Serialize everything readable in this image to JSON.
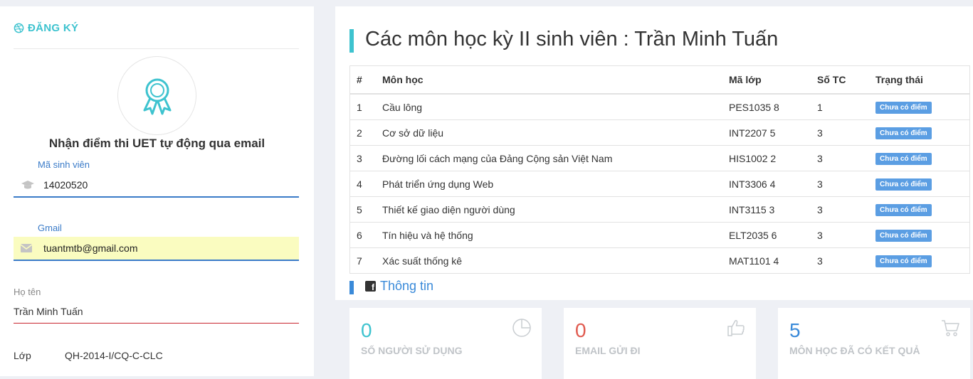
{
  "left": {
    "register_title": "ĐĂNG KÝ",
    "heading": "Nhận điểm thi UET tự động qua email",
    "student_id": {
      "label": "Mã sinh viên",
      "value": "14020520"
    },
    "gmail": {
      "label": "Gmail",
      "value": "tuantmtb@gmail.com"
    },
    "full_name": {
      "label": "Họ tên",
      "value": "Trần Minh Tuấn"
    },
    "class": {
      "label": "Lớp",
      "value": "QH-2014-I/CQ-C-CLC"
    }
  },
  "main": {
    "title": "Các môn học kỳ II sinh viên : Trần Minh Tuấn",
    "table": {
      "headers": [
        "#",
        "Môn học",
        "Mã lớp",
        "Số TC",
        "Trạng thái"
      ],
      "rows": [
        [
          "1",
          "Cầu lông",
          "PES1035 8",
          "1",
          "Chưa có điểm"
        ],
        [
          "2",
          "Cơ sở dữ liệu",
          "INT2207 5",
          "3",
          "Chưa có điểm"
        ],
        [
          "3",
          "Đường lối cách mạng của Đảng Cộng sản Việt Nam",
          "HIS1002 2",
          "3",
          "Chưa có điểm"
        ],
        [
          "4",
          "Phát triển ứng dụng Web",
          "INT3306 4",
          "3",
          "Chưa có điểm"
        ],
        [
          "5",
          "Thiết kế giao diện người dùng",
          "INT3115 3",
          "3",
          "Chưa có điểm"
        ],
        [
          "6",
          "Tín hiệu và hệ thống",
          "ELT2035 6",
          "3",
          "Chưa có điểm"
        ],
        [
          "7",
          "Xác suất thống kê",
          "MAT1101 4",
          "3",
          "Chưa có điểm"
        ]
      ]
    },
    "info_title": "Thông tin",
    "stats": [
      {
        "value": "0",
        "label": "SỐ NGƯỜI SỬ DỤNG",
        "color": "#3ec3cf",
        "icon": "pie-chart-icon"
      },
      {
        "value": "0",
        "label": "EMAIL GỬI ĐI",
        "color": "#e05a4f",
        "icon": "thumbs-up-icon"
      },
      {
        "value": "5",
        "label": "MÔN HỌC ĐÃ CÓ KẾT QUẢ",
        "color": "#3a8ad9",
        "icon": "cart-icon"
      }
    ]
  },
  "colors": {
    "accent": "#3ec3cf",
    "link_blue": "#3a7bc8",
    "status_badge": "#5b9ee3",
    "autofill_yellow": "#fafcc0"
  }
}
